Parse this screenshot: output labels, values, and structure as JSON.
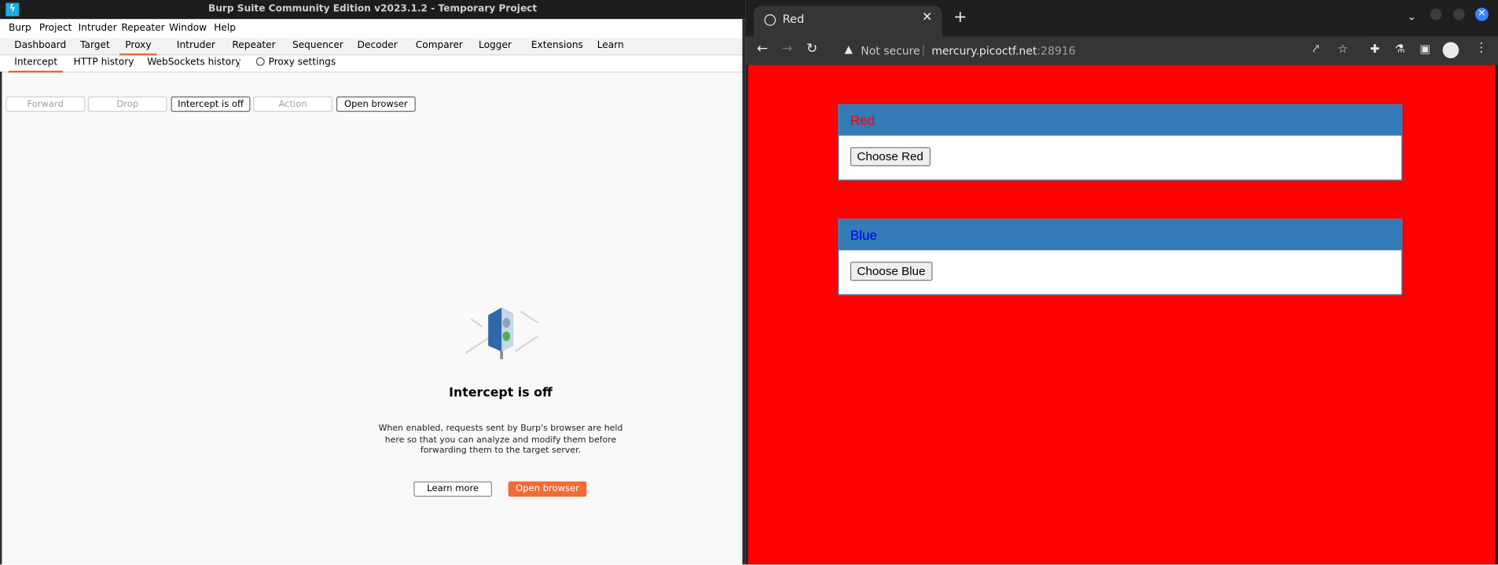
{
  "burp": {
    "title": "Burp Suite Community Edition v2023.1.2 - Temporary Project",
    "menu": [
      "Burp",
      "Project",
      "Intruder",
      "Repeater",
      "Window",
      "Help"
    ],
    "tabs": [
      "Dashboard",
      "Target",
      "Proxy",
      "Intruder",
      "Repeater",
      "Sequencer",
      "Decoder",
      "Comparer",
      "Logger",
      "Extensions",
      "Learn"
    ],
    "active_tab": "Proxy",
    "subtabs": [
      "Intercept",
      "HTTP history",
      "WebSockets history"
    ],
    "active_subtab": "Intercept",
    "proxy_settings": "Proxy settings",
    "toolbar": {
      "forward": "Forward",
      "drop": "Drop",
      "intercept": "Intercept is off",
      "action": "Action",
      "open_browser": "Open browser"
    },
    "intercept_panel": {
      "icon": "traffic-light-icon",
      "title": "Intercept is off",
      "description": "When enabled, requests sent by Burp's browser are held here so that you can analyze and modify them before forwarding them to the target server.",
      "learn_more": "Learn more",
      "open_browser": "Open browser"
    },
    "colors": {
      "accent": "#e8663a",
      "primary_button": "#f26b34"
    }
  },
  "browser": {
    "tab_title": "Red",
    "address": {
      "security": "Not secure",
      "host": "mercury.picoctf.net",
      "port": ":28916"
    },
    "page": {
      "background": "#ff0000",
      "panels": [
        {
          "heading": "Red",
          "heading_color": "#ff0000",
          "button": "Choose Red"
        },
        {
          "heading": "Blue",
          "heading_color": "#0000ff",
          "button": "Choose Blue"
        }
      ]
    }
  }
}
